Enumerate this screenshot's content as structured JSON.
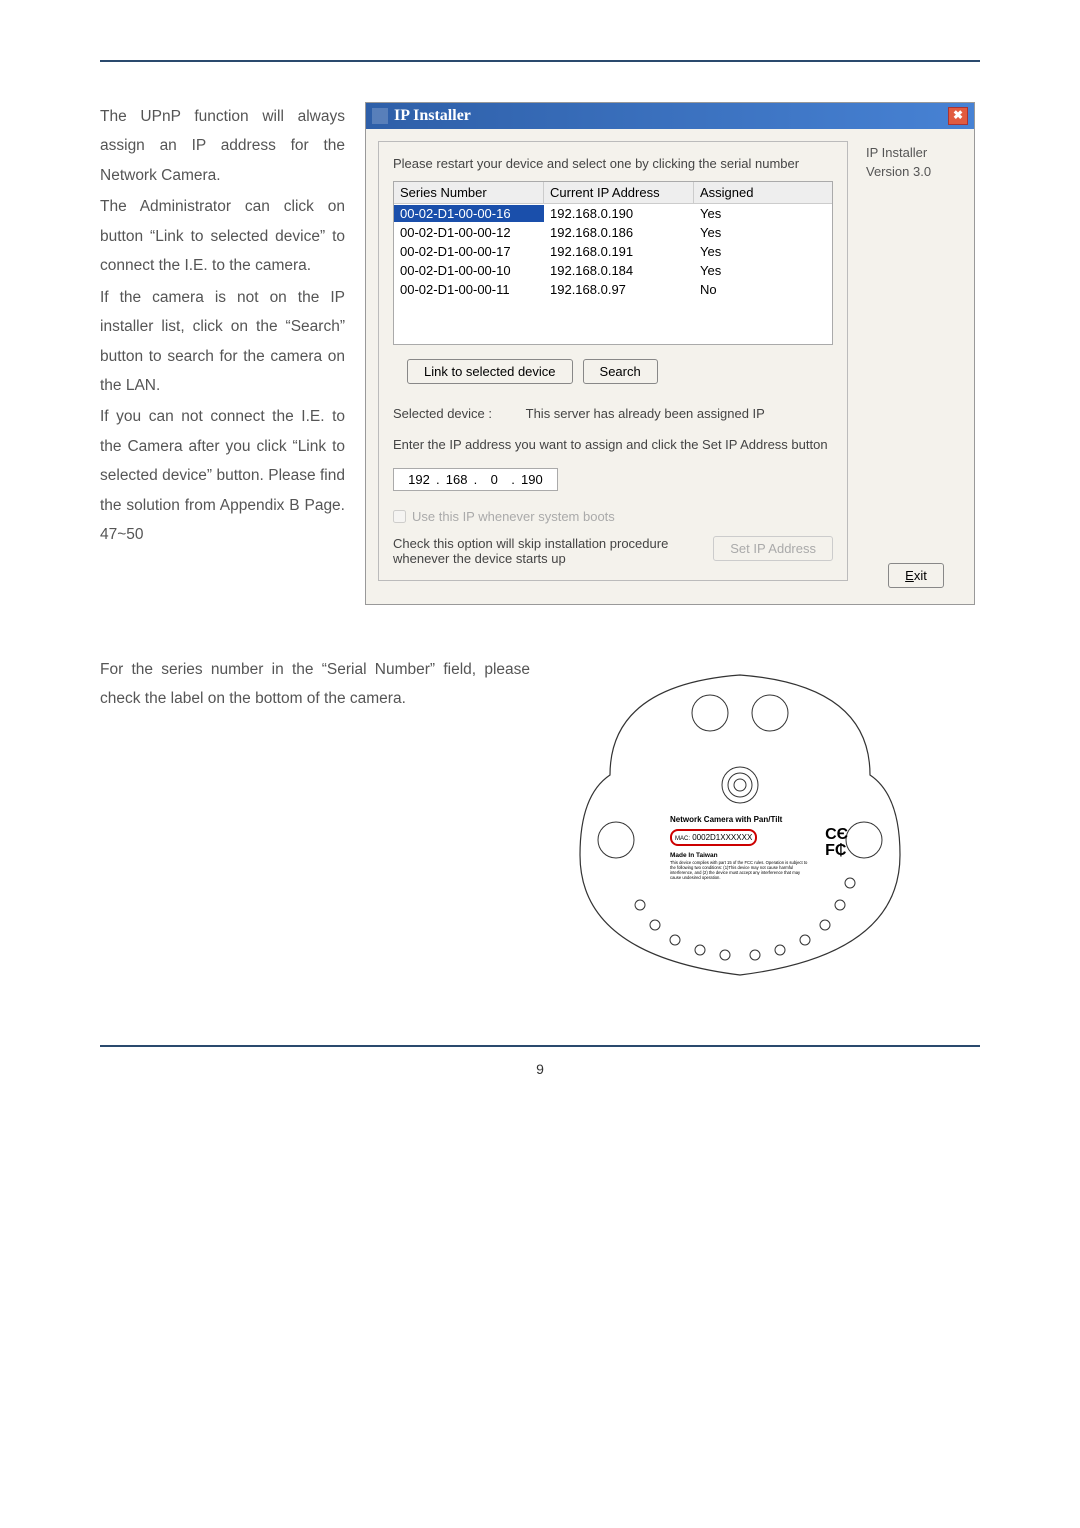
{
  "paragraphs": {
    "p1": "The UPnP function will always assign an IP address for the Network Camera.",
    "p2": "The Administrator can click on button “Link to selected device” to connect the I.E. to the camera.",
    "p3": "If the camera is not on the IP installer list, click on the “Search” button to search for the camera on the LAN.",
    "p4": "If you can not connect the I.E. to the Camera after you click “Link to selected device” button. Please find the solution from Appendix B Page. 47~50"
  },
  "window": {
    "title": "IP Installer",
    "close": "✖",
    "instruction": "Please restart your device and select one by clicking the serial number",
    "info_name": "IP Installer",
    "info_version": "Version 3.0",
    "headers": {
      "sn": "Series Number",
      "ip": "Current IP Address",
      "as": "Assigned"
    },
    "rows": [
      {
        "sn": "00-02-D1-00-00-16",
        "ip": "192.168.0.190",
        "as": "Yes",
        "selected": true
      },
      {
        "sn": "00-02-D1-00-00-12",
        "ip": "192.168.0.186",
        "as": "Yes",
        "selected": false
      },
      {
        "sn": "00-02-D1-00-00-17",
        "ip": "192.168.0.191",
        "as": "Yes",
        "selected": false
      },
      {
        "sn": "00-02-D1-00-00-10",
        "ip": "192.168.0.184",
        "as": "Yes",
        "selected": false
      },
      {
        "sn": "00-02-D1-00-00-11",
        "ip": "192.168.0.97",
        "as": "No",
        "selected": false
      }
    ],
    "btn_link": "Link to selected device",
    "btn_search": "Search",
    "selected_label": "Selected device :",
    "selected_msg": "This server has already been assigned IP",
    "enter_ip_label": "Enter the IP address you want to assign and click the Set IP Address button",
    "ip_octets": [
      "192",
      "168",
      "0",
      "190"
    ],
    "checkbox_label": "Use this IP whenever system boots",
    "hint_label": "Check this option will skip installation procedure whenever the device starts up",
    "btn_setip": "Set IP Address",
    "btn_exit": "Exit"
  },
  "lower": {
    "text": "For the series number in the “Serial Number” field, please check the label on the bottom of the camera."
  },
  "diagram": {
    "title": "Network Camera with Pan/Tilt",
    "mac_label": "MAC:",
    "mac_value": "0002D1XXXXXX",
    "made_in": "Made In Taiwan",
    "fine_print": "This device complies with part 15 of the FCC rules. Operation is subject to the following two conditions: (1)This device may not cause harmful interference, and (2) the device must accept any interference that may cause undesired operation.",
    "ce": "CЄ",
    "fc": "F₵"
  },
  "page_number": "9"
}
